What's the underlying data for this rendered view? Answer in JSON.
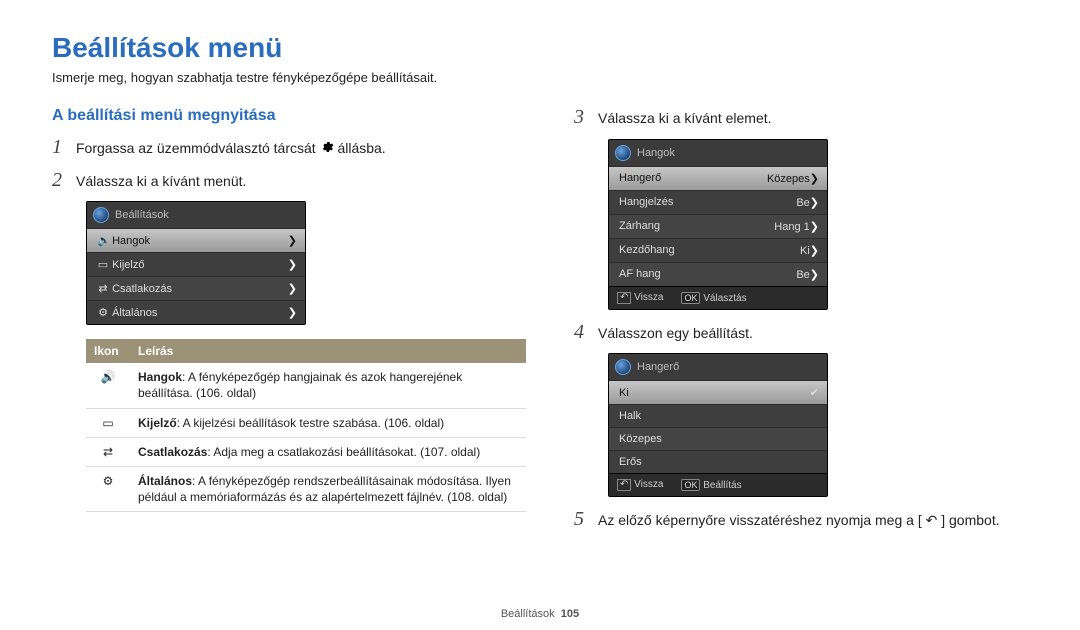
{
  "title": "Beállítások menü",
  "intro": "Ismerje meg, hogyan szabhatja testre fényképezőgépe beállításait.",
  "section_heading": "A beállítási menü megnyitása",
  "steps": {
    "s1": {
      "num": "1",
      "text_a": "Forgassa az üzemmódválasztó tárcsát ",
      "text_b": " állásba."
    },
    "s2": {
      "num": "2",
      "text": "Válassza ki a kívánt menüt."
    },
    "s3": {
      "num": "3",
      "text": "Válassza ki a kívánt elemet."
    },
    "s4": {
      "num": "4",
      "text": "Válasszon egy beállítást."
    },
    "s5": {
      "num": "5",
      "text_a": "Az előző képernyőre visszatéréshez nyomja meg a [",
      "text_b": "] gombot."
    }
  },
  "cam1": {
    "title": "Beállítások",
    "rows": [
      "Hangok",
      "Kijelző",
      "Csatlakozás",
      "Általános"
    ]
  },
  "cam2": {
    "title": "Hangok",
    "rows": [
      {
        "label": "Hangerő",
        "value": "Közepes"
      },
      {
        "label": "Hangjelzés",
        "value": "Be"
      },
      {
        "label": "Zárhang",
        "value": "Hang 1"
      },
      {
        "label": "Kezdőhang",
        "value": "Ki"
      },
      {
        "label": "AF hang",
        "value": "Be"
      }
    ],
    "foot_back": "Vissza",
    "foot_ok": "Választás"
  },
  "cam3": {
    "title": "Hangerő",
    "rows": [
      "Ki",
      "Halk",
      "Közepes",
      "Erős"
    ],
    "selected": 0,
    "foot_back": "Vissza",
    "foot_ok": "Beállítás"
  },
  "table": {
    "h_icon": "Ikon",
    "h_desc": "Leírás",
    "r1_b": "Hangok",
    "r1": ": A fényképezőgép hangjainak és azok hangerejének beállítása. (106. oldal)",
    "r2_b": "Kijelző",
    "r2": ": A kijelzési beállítások testre szabása. (106. oldal)",
    "r3_b": "Csatlakozás",
    "r3": ": Adja meg a csatlakozási beállításokat. (107. oldal)",
    "r4_b": "Általános",
    "r4": ": A fényképezőgép rendszerbeállításainak módosítása. Ilyen például a memóriaformázás és az alapértelmezett fájlnév. (108. oldal)"
  },
  "footer": {
    "label": "Beállítások",
    "page": "105"
  },
  "ok_label": "OK"
}
